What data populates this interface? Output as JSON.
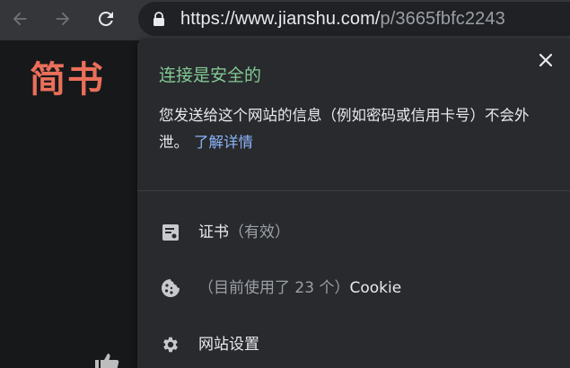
{
  "toolbar": {
    "url_host": "https://www.jianshu.com/",
    "url_path": "p/3665fbfc2243"
  },
  "page": {
    "logo": "简书"
  },
  "popup": {
    "title": "连接是安全的",
    "description": "您发送给这个网站的信息（例如密码或信用卡号）不会外泄。",
    "learn_more": "了解详情",
    "certificate": {
      "label": "证书",
      "status": "（有效）"
    },
    "cookies": {
      "label_prefix": "（目前使用了 23 个）",
      "label": "Cookie"
    },
    "site_settings": {
      "label": "网站设置"
    }
  },
  "colors": {
    "secure_green": "#81c995",
    "link_blue": "#8ab4f8",
    "brand_red": "#ea6f5a"
  }
}
